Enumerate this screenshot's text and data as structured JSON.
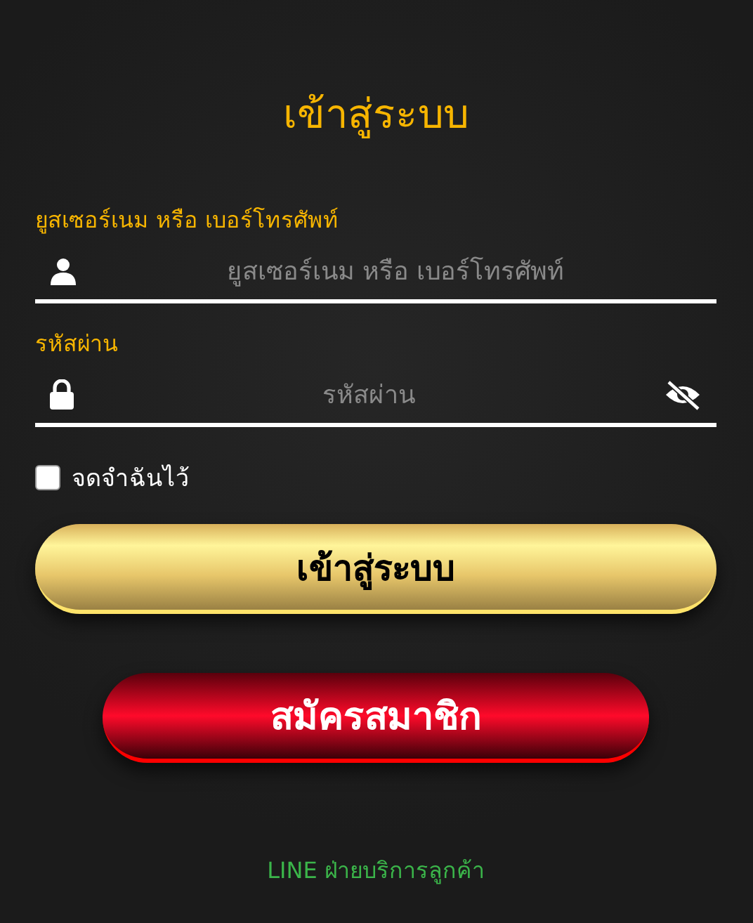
{
  "title": "เข้าสู่ระบบ",
  "fields": [
    {
      "kind": "user",
      "label": "ยูสเซอร์เนม หรือ เบอร์โทรศัพท์",
      "placeholder": "ยูสเซอร์เนม หรือ เบอร์โทรศัพท์"
    },
    {
      "kind": "password",
      "label": "รหัสผ่าน",
      "placeholder": "รหัสผ่าน"
    }
  ],
  "remember": {
    "label": "จดจำฉันไว้",
    "checked": false
  },
  "login_button": "เข้าสู่ระบบ",
  "register_button": "สมัครสมาชิก",
  "support_link": "LINE ฝ่ายบริการลูกค้า"
}
